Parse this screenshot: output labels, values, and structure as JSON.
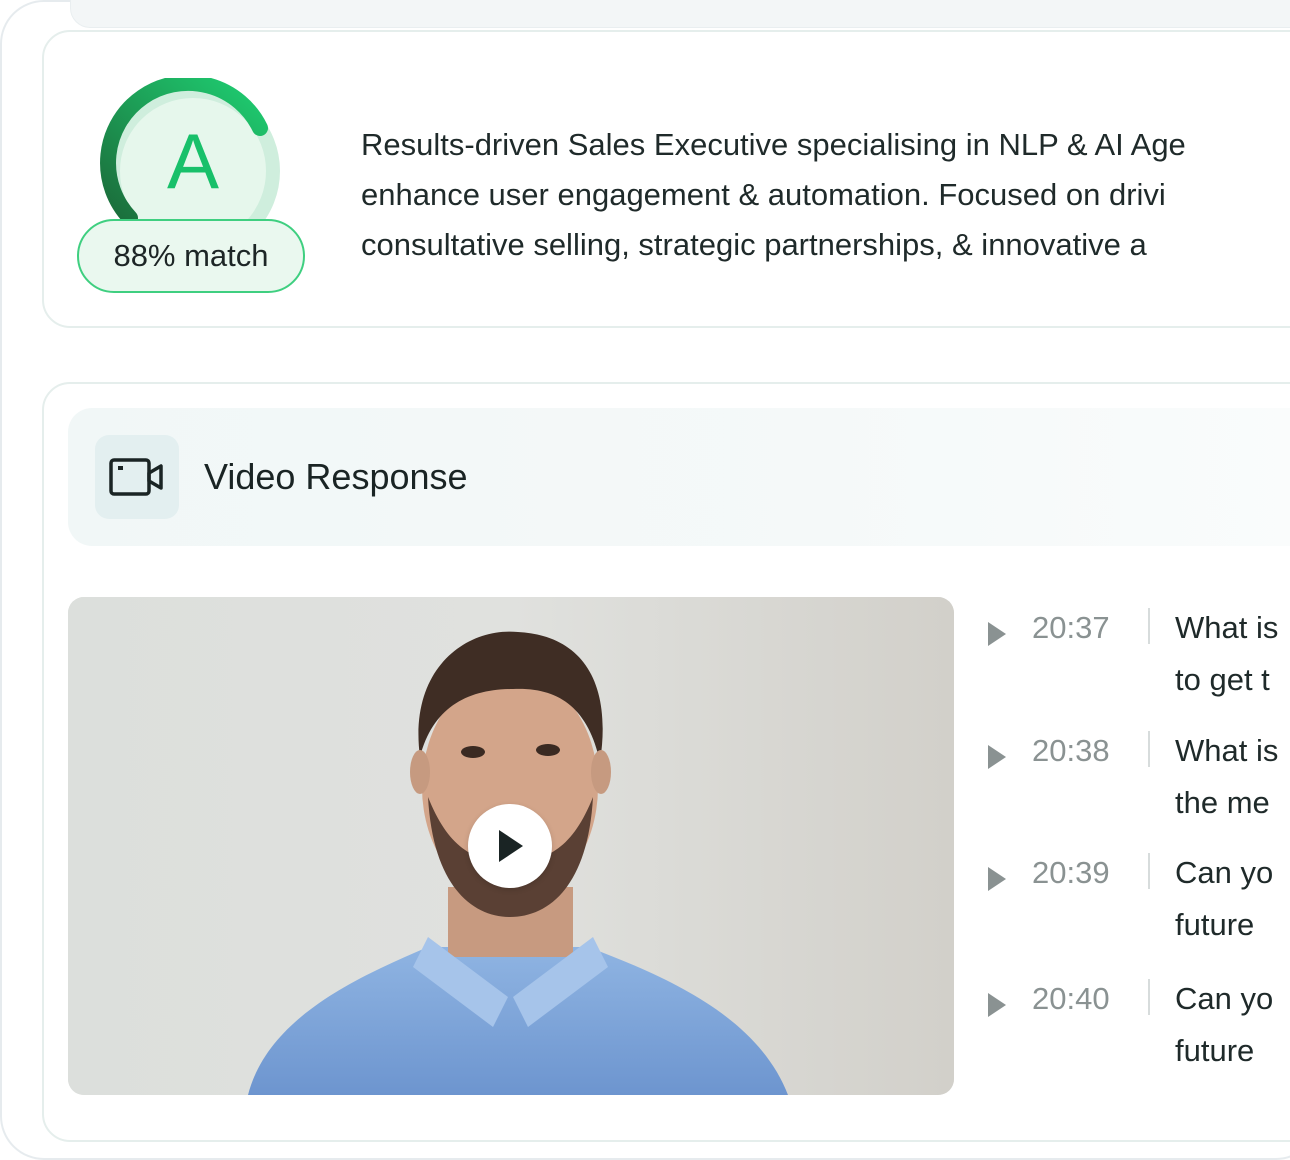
{
  "candidate": {
    "grade": "A",
    "match_label": "88% match",
    "match_percent": 88,
    "summary_lines": [
      "Results-driven Sales Executive specialising in NLP & AI Age",
      "enhance user engagement & automation. Focused on drivi",
      "consultative selling, strategic partnerships, & innovative a"
    ]
  },
  "video_section": {
    "title": "Video Response",
    "icon": "video-camera-icon"
  },
  "questions": [
    {
      "time": "20:37",
      "line1": "What is",
      "line2": "to get t"
    },
    {
      "time": "20:38",
      "line1": "What is",
      "line2": "the me"
    },
    {
      "time": "20:39",
      "line1": "Can yo",
      "line2": "future"
    },
    {
      "time": "20:40",
      "line1": "Can yo",
      "line2": "future"
    }
  ],
  "colors": {
    "accent_green": "#18c06a",
    "ring_dark": "#1f8a4a",
    "pill_border": "#3fcf80"
  }
}
